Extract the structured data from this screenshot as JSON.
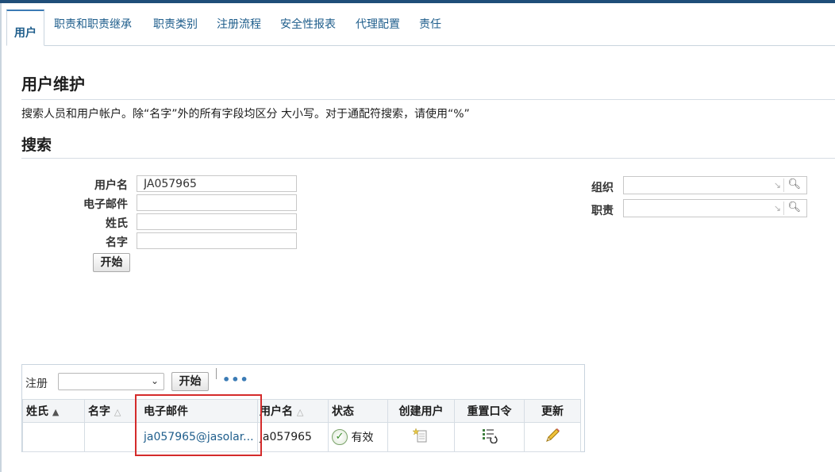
{
  "tabs": [
    "用户",
    "职责和职责继承",
    "职责类别",
    "注册流程",
    "安全性报表",
    "代理配置",
    "责任"
  ],
  "page_title": "用户维护",
  "description": "搜索人员和用户帐户。除“名字”外的所有字段均区分 大小写。对于通配符搜索，请使用“%”",
  "search": {
    "title": "搜索",
    "fields": {
      "username_label": "用户名",
      "username_value": "JA057965",
      "email_label": "电子邮件",
      "email_value": "",
      "lastname_label": "姓氏",
      "lastname_value": "",
      "firstname_label": "名字",
      "firstname_value": ""
    },
    "org_label": "组织",
    "resp_label": "职责",
    "go_label": "开始"
  },
  "results": {
    "register_label": "注册",
    "register_selected": "",
    "go_label": "开始",
    "more_label": "•••",
    "columns": [
      "姓氏",
      "名字",
      "电子邮件",
      "用户名",
      "状态",
      "创建用户",
      "重置口令",
      "更新"
    ],
    "rows": [
      {
        "lastname": "",
        "firstname": "",
        "email": "ja057965@jasolar...",
        "username": "ja057965",
        "status": "有效"
      }
    ]
  },
  "icons": {
    "sort_asc": "sort-ascending-icon",
    "status": "check-circle-icon",
    "create_user": "create-user-icon",
    "reset_password": "reset-password-icon",
    "update": "pencil-icon",
    "lov_arrow": "lov-arrow-icon",
    "search": "magnifier-icon"
  },
  "colors": {
    "accent": "#1f5e8c",
    "topbar": "#1f4e79",
    "highlight": "#d42b2b"
  }
}
